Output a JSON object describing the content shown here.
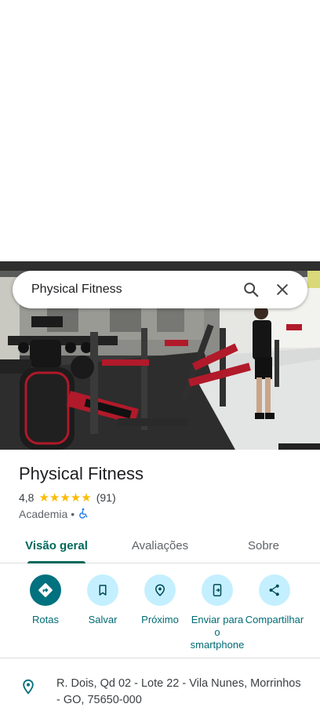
{
  "search": {
    "query": "Physical Fitness"
  },
  "place": {
    "name": "Physical Fitness",
    "rating": "4,8",
    "stars": "★★★★★",
    "review_count": "(91)",
    "category": "Academia",
    "separator": "•"
  },
  "tabs": [
    {
      "label": "Visão geral",
      "active": true
    },
    {
      "label": "Avaliações",
      "active": false
    },
    {
      "label": "Sobre",
      "active": false
    }
  ],
  "actions": [
    {
      "label": "Rotas",
      "icon": "directions-icon"
    },
    {
      "label": "Salvar",
      "icon": "bookmark-icon"
    },
    {
      "label": "Próximo",
      "icon": "nearby-icon"
    },
    {
      "label": "Enviar para o smartphone",
      "icon": "send-to-phone-icon"
    },
    {
      "label": "Compartilhar",
      "icon": "share-icon"
    }
  ],
  "address": {
    "text": "R. Dois, Qd 02 - Lote 22 - Vila Nunes, Morrinhos - GO, 75650-000"
  },
  "colors": {
    "accent": "#00685b",
    "action_bg": "#c4efff",
    "primary_button": "#00717e",
    "star": "#fbbc04"
  }
}
